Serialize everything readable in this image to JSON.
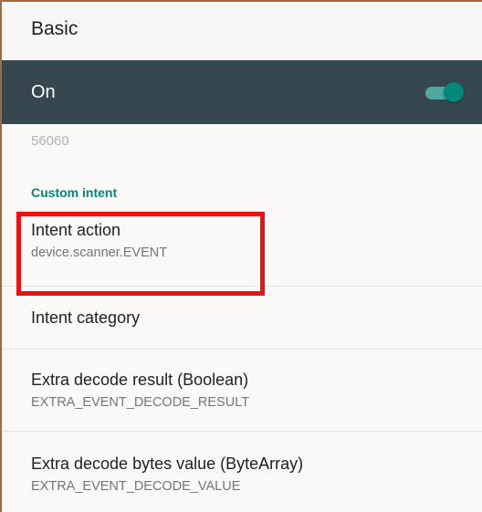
{
  "header": {
    "title": "Basic"
  },
  "toggle": {
    "label": "On",
    "state": "on",
    "accent": "#00897b"
  },
  "port_value": "56060",
  "custom_intent": {
    "category_title": "Custom intent",
    "items": [
      {
        "title": "Intent action",
        "summary": "device.scanner.EVENT"
      },
      {
        "title": "Intent category",
        "summary": ""
      },
      {
        "title": "Extra decode result (Boolean)",
        "summary": "EXTRA_EVENT_DECODE_RESULT"
      },
      {
        "title": "Extra decode bytes value (ByteArray)",
        "summary": "EXTRA_EVENT_DECODE_VALUE"
      }
    ]
  },
  "colors": {
    "appbar": "#37474f",
    "highlight_box": "#ee1111",
    "category_text": "#00897b"
  }
}
